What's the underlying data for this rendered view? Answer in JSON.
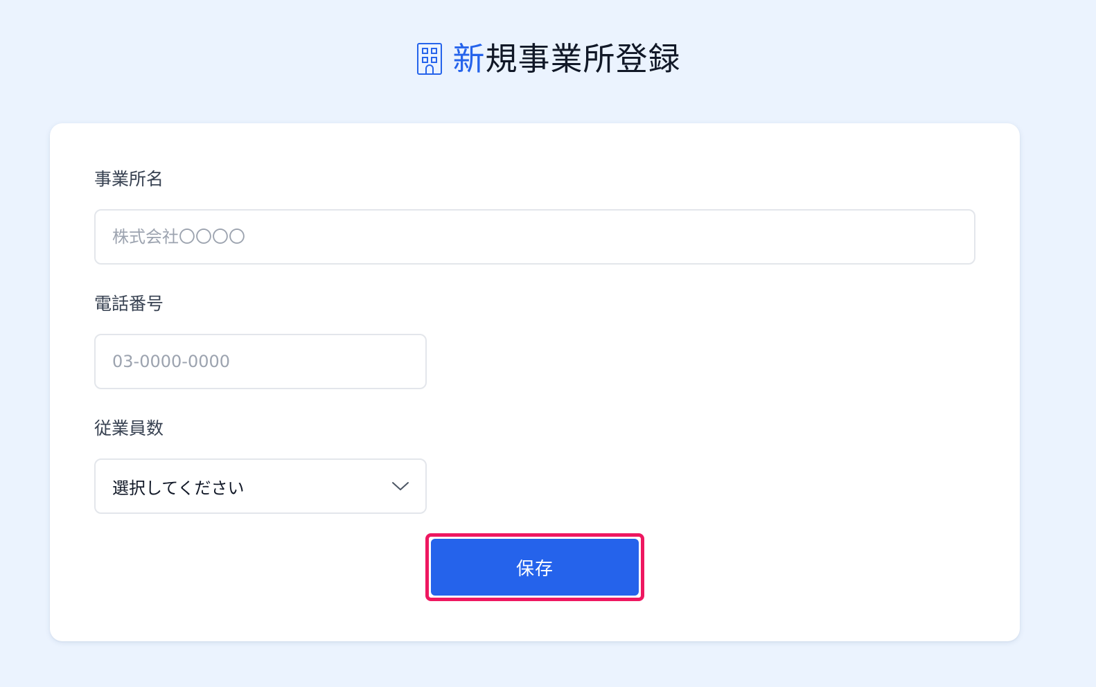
{
  "header": {
    "icon": "building-icon",
    "title_accent": "新",
    "title_rest": "規事業所登録",
    "accent_color": "#2563eb"
  },
  "form": {
    "office_name": {
      "label": "事業所名",
      "placeholder": "株式会社〇〇〇〇",
      "value": ""
    },
    "phone": {
      "label": "電話番号",
      "placeholder": "03-0000-0000",
      "value": ""
    },
    "employees": {
      "label": "従業員数",
      "selected": "選択してください",
      "icon": "chevron-down-icon"
    },
    "save_label": "保存"
  },
  "colors": {
    "background": "#ebf3fe",
    "primary_button": "#2563eb",
    "highlight_border": "#ee1760"
  }
}
